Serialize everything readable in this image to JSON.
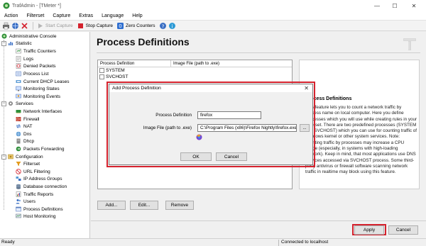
{
  "window": {
    "title": "TrafAdmin - [TMeter *]",
    "minimize_glyph": "—",
    "maximize_glyph": "☐",
    "close_glyph": "✕"
  },
  "menu": [
    {
      "label": "Action",
      "key": "A"
    },
    {
      "label": "Filterset",
      "key": ""
    },
    {
      "label": "Capture",
      "key": ""
    },
    {
      "label": "Extras",
      "key": ""
    },
    {
      "label": "Language",
      "key": ""
    },
    {
      "label": "Help",
      "key": ""
    }
  ],
  "toolbar": {
    "start_capture": "Start Capture",
    "stop_capture": "Stop Capture",
    "zero_counters": "Zero Counters"
  },
  "tree": {
    "root": "Administrative Console",
    "groups": [
      {
        "label": "Statistic",
        "items": [
          "Traffic Counters",
          "Logs",
          "Denied Packets",
          "Process List",
          "Current DHCP Leases",
          "Monitoring States",
          "Monitoring Events"
        ]
      },
      {
        "label": "Services",
        "items": [
          "Network Interfaces",
          "Firewall",
          "NAT",
          "Dns",
          "Dhcp",
          "Packets Forwarding"
        ]
      },
      {
        "label": "Configuration",
        "items": [
          "Filterset",
          "URL Filtering",
          "IP Address Groups",
          "Database connection",
          "Traffic Reports",
          "Users",
          "Process Definitions",
          "Host Monitoring"
        ]
      }
    ]
  },
  "main": {
    "title": "Process Definitions",
    "table": {
      "columns": [
        "Process Definition",
        "Image File (path to .exe)"
      ],
      "rows": [
        {
          "name": "SYSTEM",
          "path": ""
        },
        {
          "name": "SVCHOST",
          "path": ""
        }
      ]
    },
    "buttons": {
      "add": "Add...",
      "edit": "Edit...",
      "remove": "Remove"
    },
    "info": {
      "title": "Process Definitions",
      "text": "This feature lets you to count a network traffic by process name on local computer. Here you define processes which you will use while creating rules in your Filterset. There are two predefined processes (SYSTEM and SVCHOST) which you can use for counting traffic of Windows kernel or other system services. Note: counting traffic by processes may increase a CPU usage (especially, in systems with high-loading network). Keep in mind, that most applications use DNS services accessed via SVCHOST process. Some third-party antivirus or firewall software scanning network traffic in realtime may block using this feature."
    },
    "footer": {
      "apply": "Apply",
      "cancel": "Cancel"
    }
  },
  "dialog": {
    "title": "Add Process Definition",
    "process_label": "Process Definition",
    "process_value": "firefox",
    "image_label": "Image File (path to .exe)",
    "image_value": "C:\\Program Files (x86)\\Firefox Nightly\\firefox.exe",
    "browse_glyph": "...",
    "ok": "OK",
    "cancel": "Cancel"
  },
  "status": {
    "left": "Ready",
    "right": "Connected to localhost"
  },
  "colors": {
    "highlight": "#d4222d",
    "tree_bg": "#ffffff",
    "window_bg": "#f0f0f0"
  }
}
